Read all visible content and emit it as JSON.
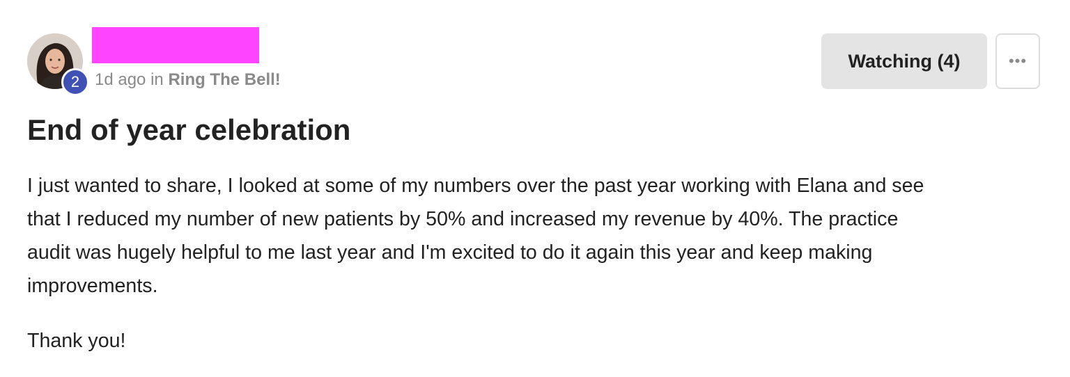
{
  "post": {
    "author": {
      "avatar_icon": "avatar-photo",
      "level": "2",
      "name_redaction_color": "#ff44ff"
    },
    "meta": {
      "time_ago": "1d ago",
      "in_text": "in",
      "group_name": "Ring The Bell!"
    },
    "actions": {
      "watching_label": "Watching (4)",
      "more_icon": "more-horizontal-icon",
      "more_glyph": "•••"
    },
    "title": "End of year celebration",
    "body_lines": [
      "I just wanted to share, I looked at some of my numbers over the past year working with Elana and see",
      "that I reduced my number of new patients by 50% and increased my revenue by 40%. The practice",
      "audit was hugely helpful to me last year and I'm excited to do it again this year and keep making",
      "improvements."
    ],
    "closing": "Thank you!"
  },
  "colors": {
    "badge": "#3f51b5",
    "button_bg": "#e4e4e4",
    "meta_text": "#8a8a8a"
  }
}
